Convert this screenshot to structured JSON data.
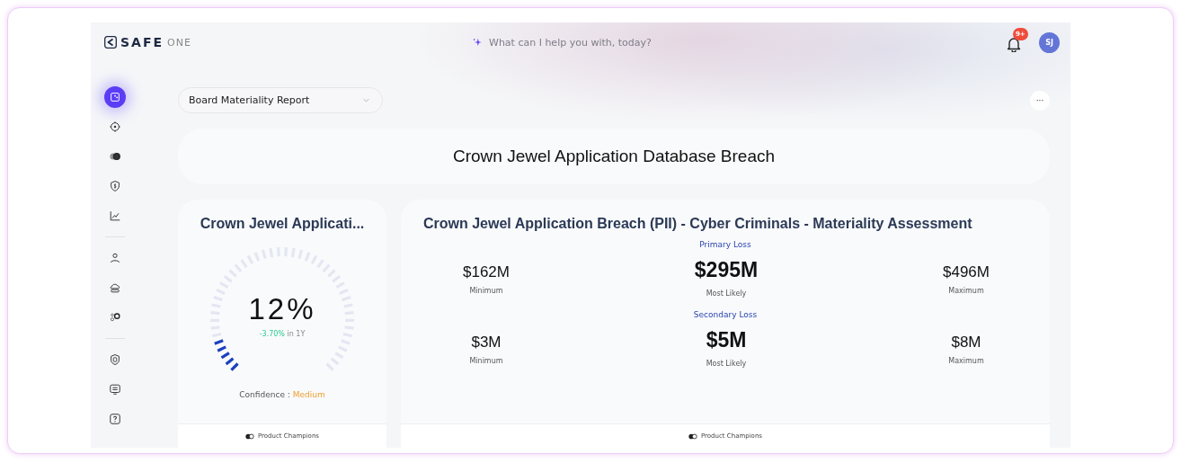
{
  "header": {
    "brand_mark": "SAFE",
    "brand_suffix": "ONE",
    "search": {
      "placeholder": "What can I help you with, today?"
    },
    "notifications_badge": "9+",
    "avatar_initials": "SJ"
  },
  "sidebar": {
    "groups": [
      [
        {
          "selected": true
        },
        {
          "selected": false
        },
        {
          "selected": false
        },
        {
          "selected": false
        },
        {
          "selected": false
        }
      ],
      [
        {
          "selected": false
        },
        {
          "selected": false
        },
        {
          "selected": false
        }
      ],
      [
        {
          "selected": false
        },
        {
          "selected": false
        },
        {
          "selected": false
        }
      ]
    ]
  },
  "report_select": {
    "value": "Board Materiality Report"
  },
  "more_button": "···",
  "page_title": "Crown Jewel Application Database Breach",
  "gauge_card": {
    "title": "Crown Jewel Applicati...",
    "value": "12%",
    "level": 0.12,
    "change": "-3.70%",
    "change_period": "in 1Y",
    "confidence_label": "Confidence :",
    "confidence_value": "Medium",
    "footer": "Product Champions"
  },
  "assessment_card": {
    "title": "Crown Jewel Application Breach (PII) - Cyber Criminals - Materiality Assessment",
    "sections": [
      {
        "heading": "Primary Loss",
        "stats": [
          {
            "kind": "side",
            "value": "$162M",
            "label": "Minimum"
          },
          {
            "kind": "main",
            "value": "$295M",
            "label": "Most Likely"
          },
          {
            "kind": "side",
            "value": "$496M",
            "label": "Maximum"
          }
        ]
      },
      {
        "heading": "Secondary Loss",
        "stats": [
          {
            "kind": "side",
            "value": "$3M",
            "label": "Minimum"
          },
          {
            "kind": "main",
            "value": "$5M",
            "label": "Most Likely"
          },
          {
            "kind": "side",
            "value": "$8M",
            "label": "Maximum"
          }
        ]
      }
    ],
    "footer": "Product Champions"
  }
}
